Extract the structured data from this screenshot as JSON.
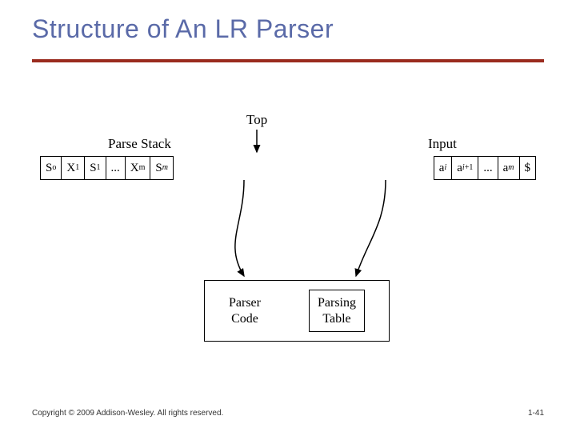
{
  "title": "Structure of An LR Parser",
  "footer": "Copyright © 2009 Addison-Wesley. All rights reserved.",
  "pagenum": "1-41",
  "labels": {
    "parse_stack": "Parse Stack",
    "top": "Top",
    "input": "Input"
  },
  "stack_cells": [
    {
      "html": "S<sub>o</sub>"
    },
    {
      "html": "X<sub>1</sub>"
    },
    {
      "html": "S<sub>1</sub>"
    },
    {
      "html": "..."
    },
    {
      "html": "X<sub>m</sub>"
    },
    {
      "html": "S<sub><i>m</i></sub>"
    }
  ],
  "input_cells": [
    {
      "html": "a<sub><i>i</i></sub>"
    },
    {
      "html": "a<sub><i>i</i>+1</sub>"
    },
    {
      "html": "..."
    },
    {
      "html": "a<sub><i>m</i></sub>"
    },
    {
      "html": "$"
    }
  ],
  "parser_box": {
    "code": "Parser\nCode",
    "table": "Parsing\nTable"
  }
}
